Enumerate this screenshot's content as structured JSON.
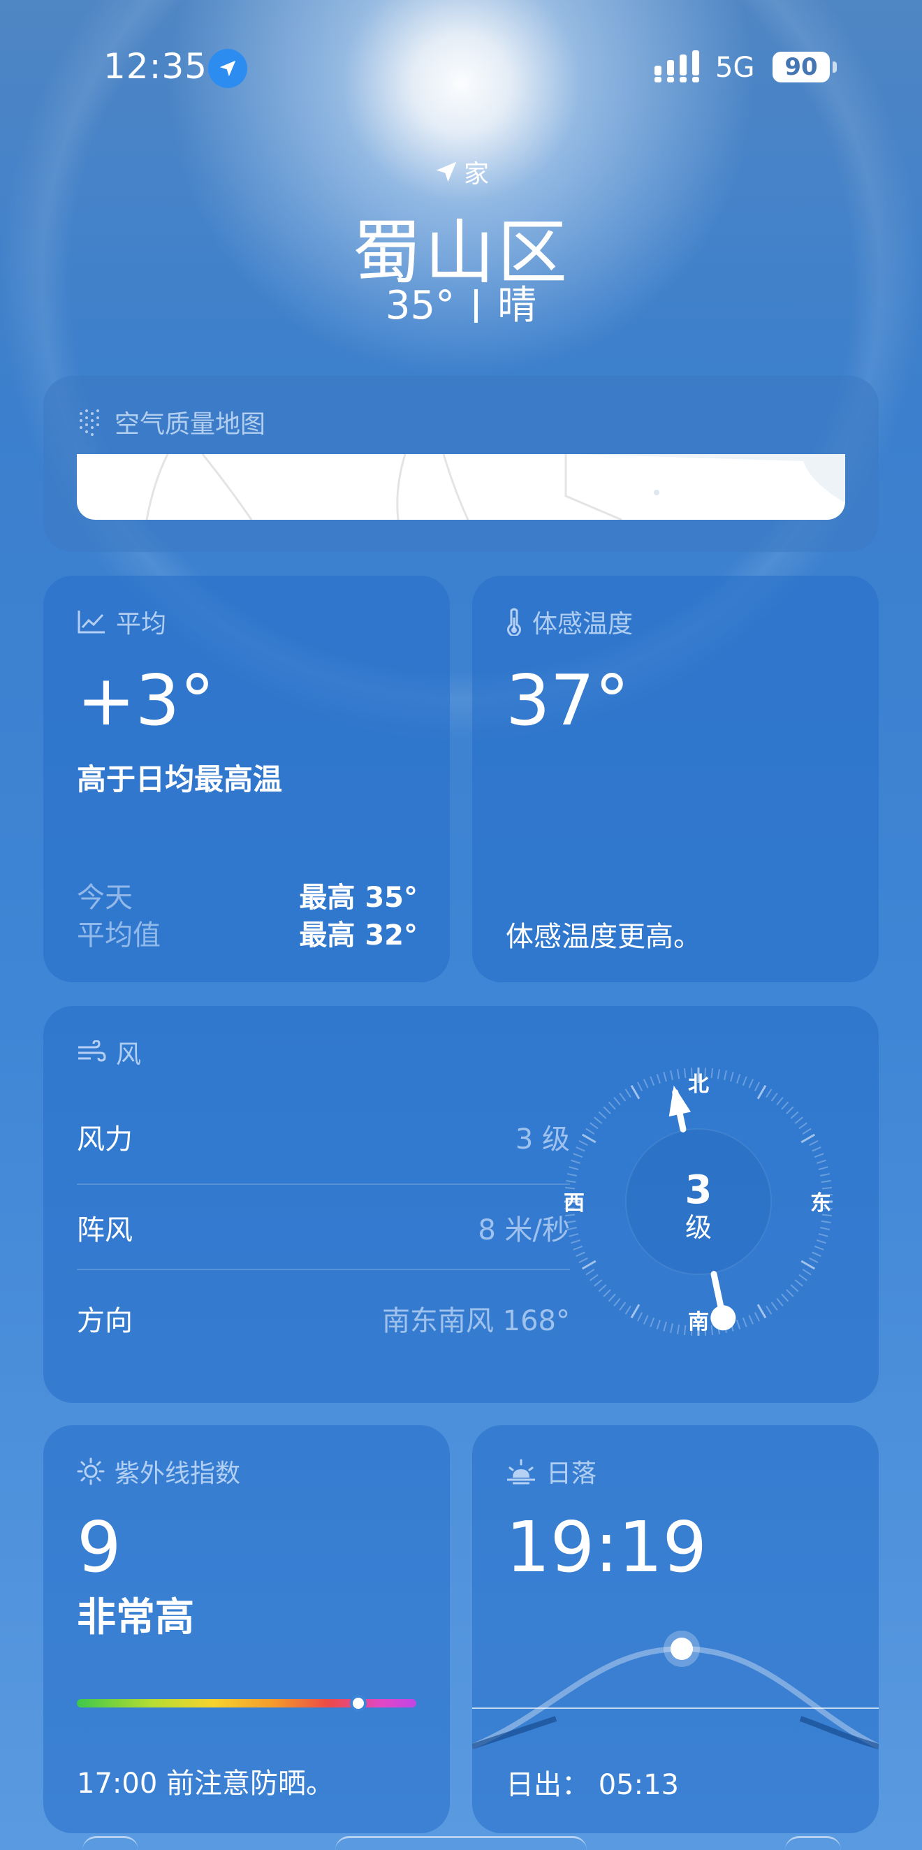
{
  "status_bar": {
    "time": "12:35",
    "network": "5G",
    "battery": "90"
  },
  "header": {
    "home_label": "家",
    "city": "蜀山区",
    "temperature": "35°",
    "condition": "晴"
  },
  "air_quality": {
    "title": "空气质量地图"
  },
  "average": {
    "title": "平均",
    "delta": "+3°",
    "description": "高于日均最高温",
    "rows": [
      {
        "label": "今天",
        "value": "最高 35°"
      },
      {
        "label": "平均值",
        "value": "最高 32°"
      }
    ]
  },
  "feels_like": {
    "title": "体感温度",
    "value": "37°",
    "description": "体感温度更高。"
  },
  "wind": {
    "title": "风",
    "rows": [
      {
        "label": "风力",
        "value": "3 级"
      },
      {
        "label": "阵风",
        "value": "8 米/秒"
      },
      {
        "label": "方向",
        "value": "南东南风 168°"
      }
    ],
    "compass": {
      "north": "北",
      "south": "南",
      "east": "东",
      "west": "西",
      "speed": "3",
      "unit": "级",
      "direction_deg": 168
    }
  },
  "uv": {
    "title": "紫外线指数",
    "value": "9",
    "level": "非常高",
    "advice": "17:00 前注意防晒。",
    "scale_position": 0.83
  },
  "sunset": {
    "title": "日落",
    "time": "19:19",
    "sunrise": "日出： 05:13"
  },
  "colors": {
    "card": "#246ec8",
    "accent": "#2d8cf0"
  }
}
